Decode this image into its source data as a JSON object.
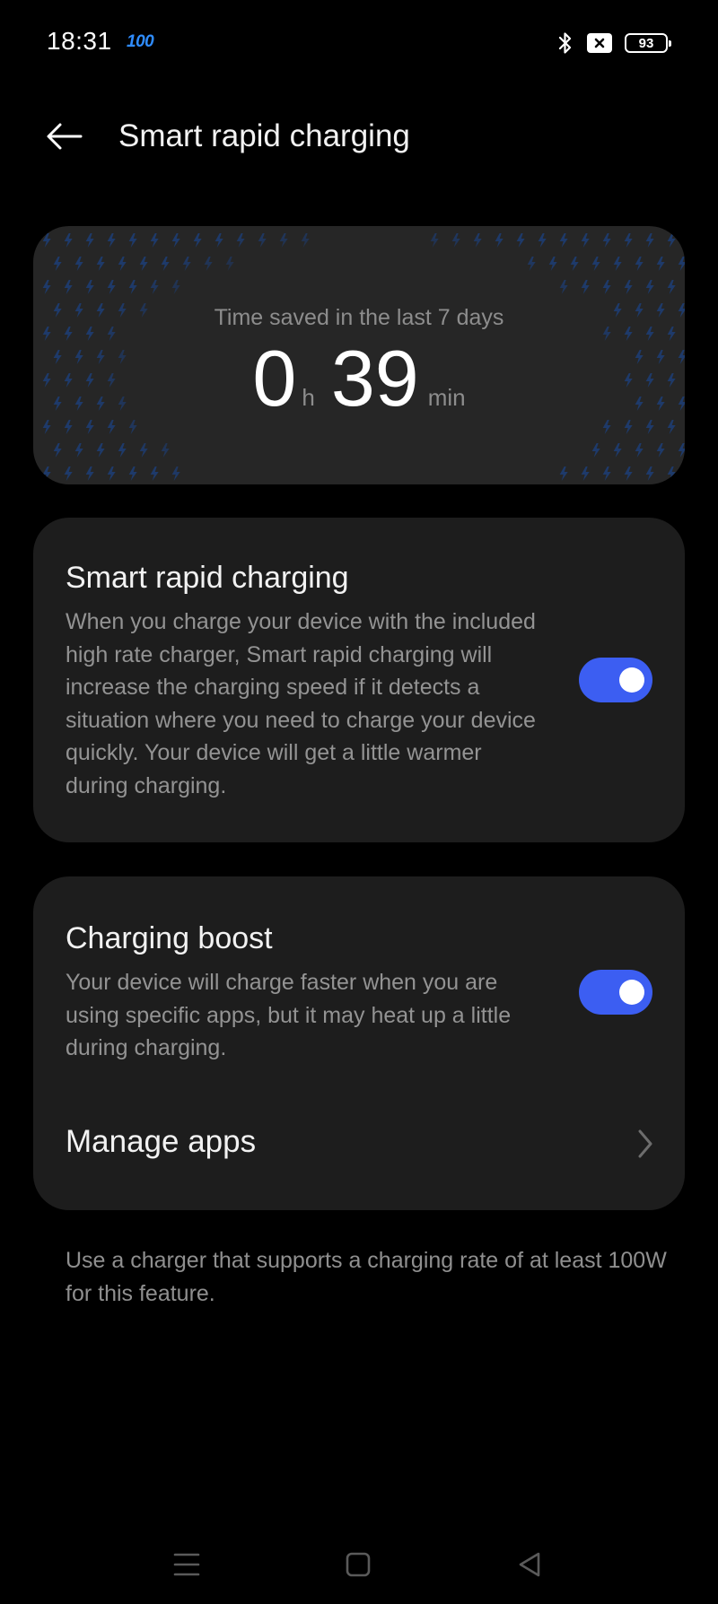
{
  "status_bar": {
    "time": "18:31",
    "charge_indicator": "100",
    "icons": [
      "bluetooth-icon",
      "sim-off-icon",
      "battery-icon"
    ],
    "battery_level": "93"
  },
  "header": {
    "back_icon": "arrow-left-icon",
    "title": "Smart rapid charging"
  },
  "summary": {
    "label": "Time saved in the last 7 days",
    "hours": "0",
    "hours_unit": "h",
    "minutes": "39",
    "minutes_unit": "min",
    "pattern_icon": "lightning-bolt-icon"
  },
  "smart_rapid": {
    "title": "Smart rapid charging",
    "description": "When you charge your device with the included high rate charger, Smart rapid charging will increase the charging speed if it detects a situation where you need to charge your device quickly. Your device will get a little warmer during charging.",
    "enabled": true
  },
  "charging_boost": {
    "title": "Charging boost",
    "description": "Your device will charge faster when you are using specific apps, but it may heat up a little during charging.",
    "enabled": true,
    "manage_apps_label": "Manage apps"
  },
  "footer_note": "Use a charger that supports a charging rate of at least 100W for this feature.",
  "nav_bar": {
    "icons": [
      "menu-icon",
      "home-icon",
      "back-triangle-icon"
    ]
  },
  "colors": {
    "background": "#000000",
    "card": "#1d1d1d",
    "accent": "#3c5ef2",
    "charge_indicator": "#2f8cff",
    "pattern_bolt": "#1e3a6a"
  }
}
